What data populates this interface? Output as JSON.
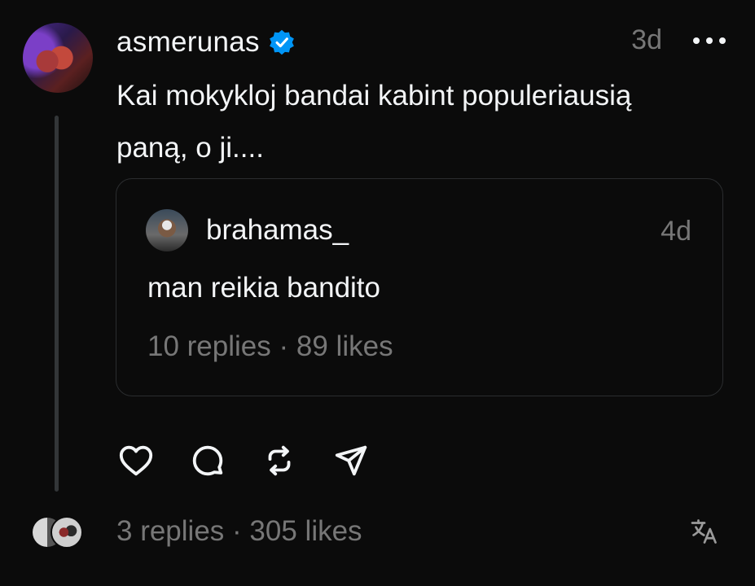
{
  "post": {
    "username": "asmerunas",
    "verified": true,
    "time": "3d",
    "text": "Kai mokykloj bandai kabint populeriausią paną, o ji....",
    "footer": {
      "replies": "3 replies",
      "separator": "·",
      "likes": "305 likes"
    }
  },
  "quoted_post": {
    "username": "brahamas_",
    "time": "4d",
    "text": "man reikia bandito",
    "stats": {
      "replies": "10 replies",
      "separator": "·",
      "likes": "89 likes"
    }
  },
  "actions": [
    {
      "icon": "heart-icon"
    },
    {
      "icon": "comment-icon"
    },
    {
      "icon": "repost-icon"
    },
    {
      "icon": "share-icon"
    }
  ],
  "colors": {
    "background": "#0b0b0b",
    "primary_text": "#f3f5f7",
    "secondary_text": "#777777",
    "verified_badge": "#0095f6",
    "border": "#2b2d2f"
  }
}
